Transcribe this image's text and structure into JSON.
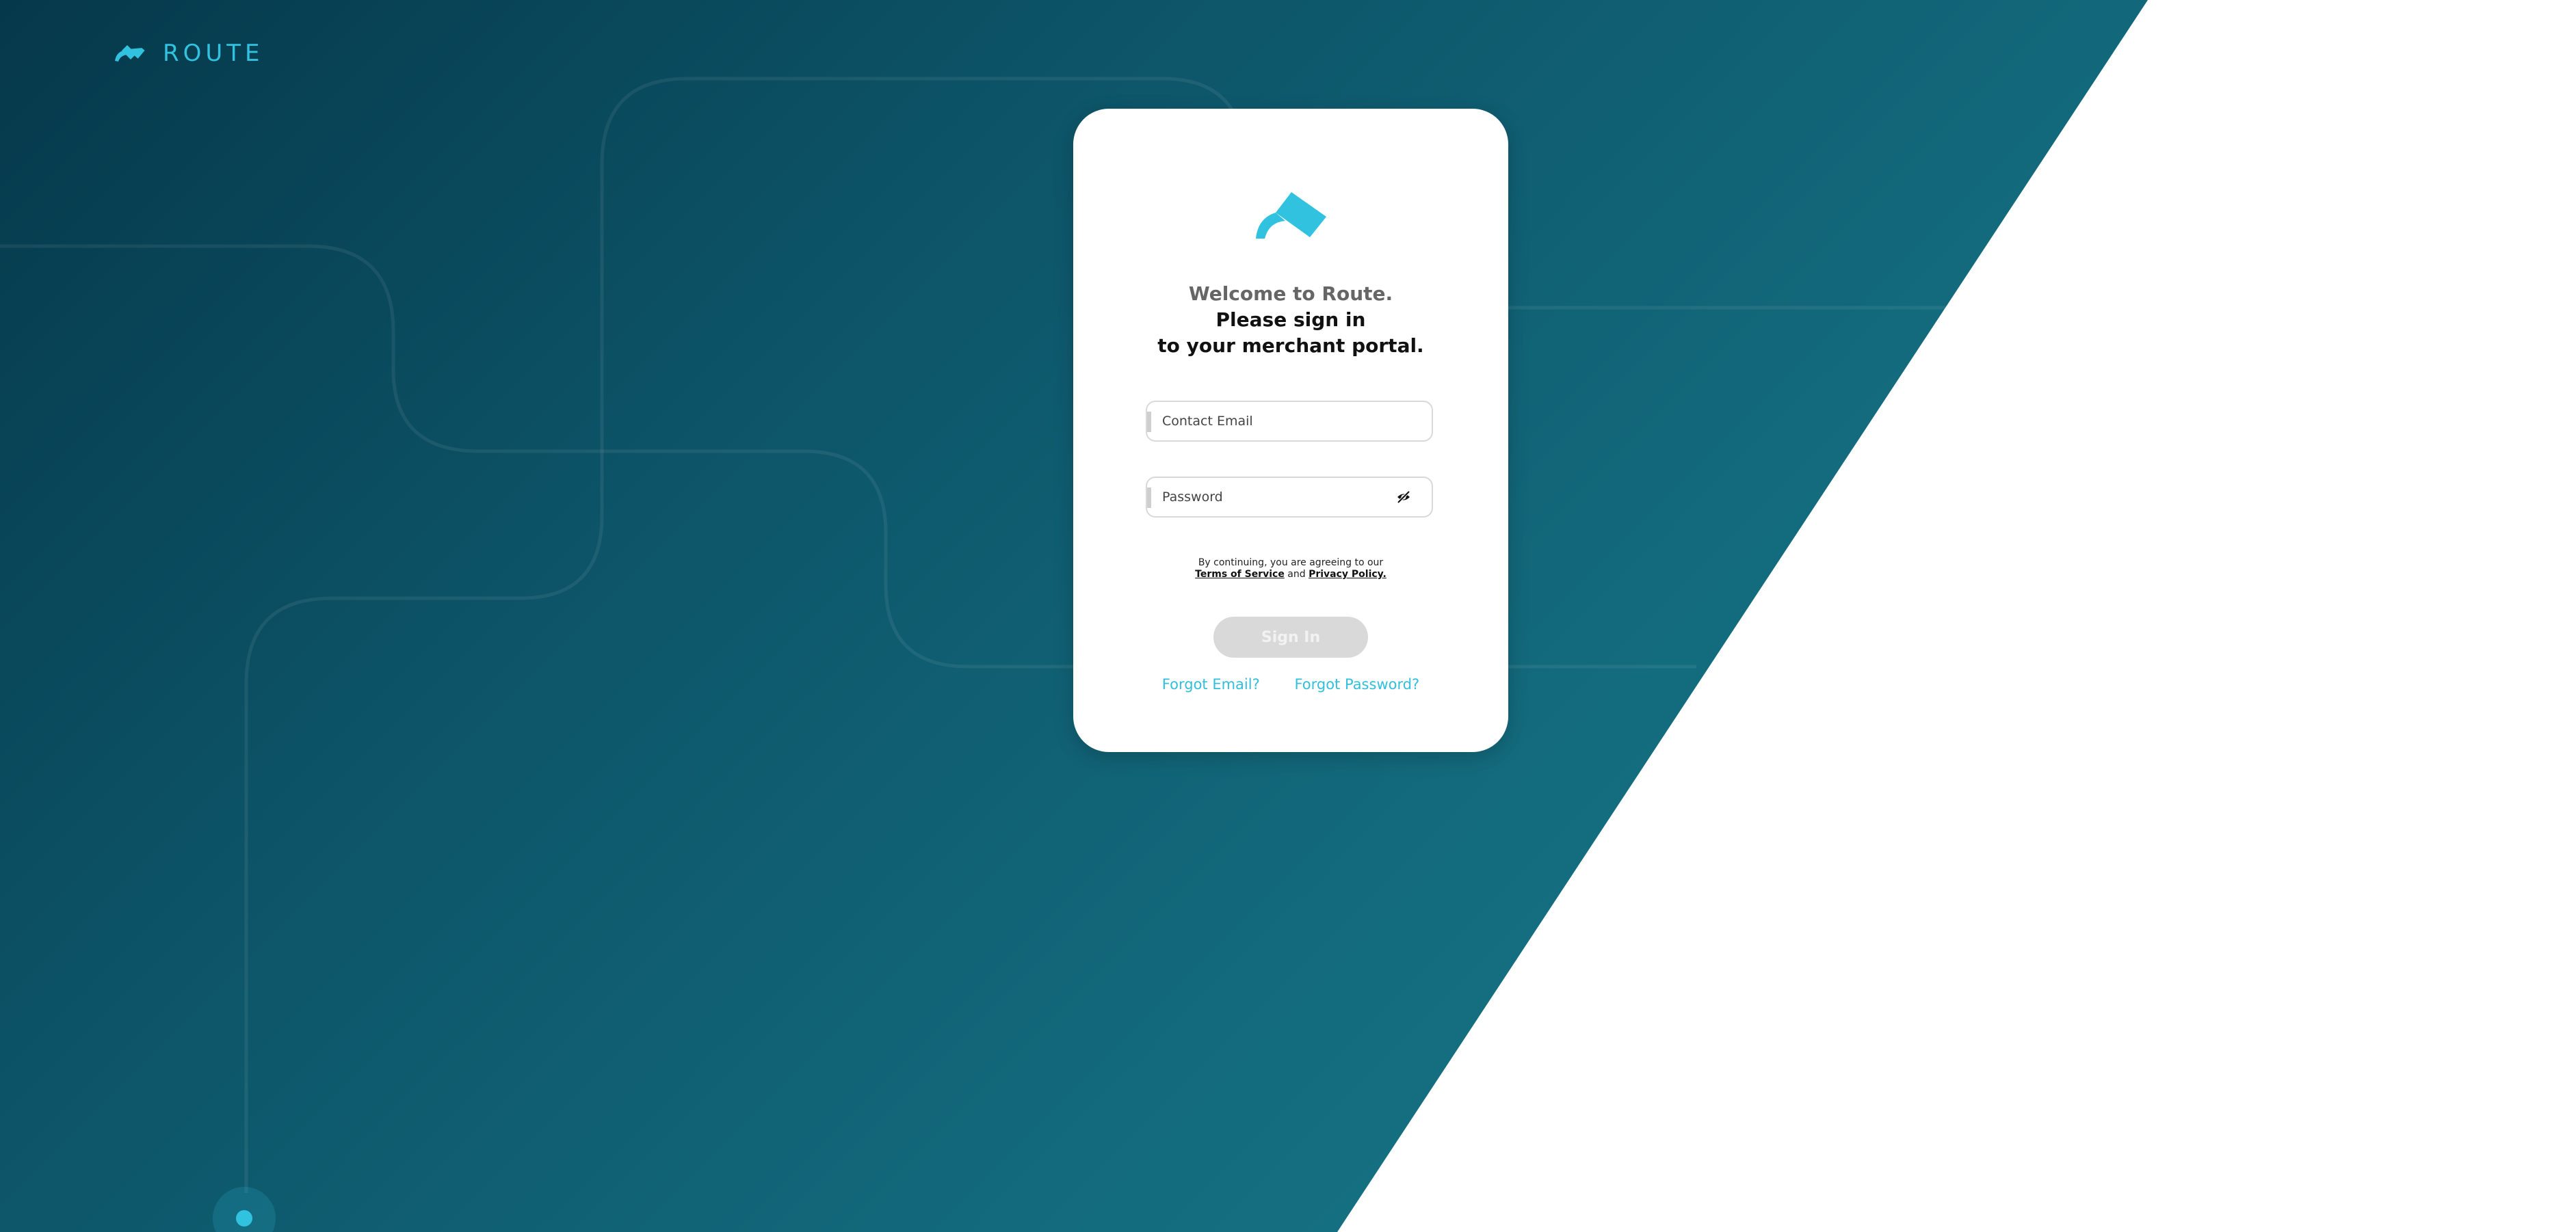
{
  "brand": {
    "name": "ROUTE",
    "accent_color": "#31c2e0",
    "background_dark": "#05384a",
    "background_light": "#178190"
  },
  "card": {
    "welcome_line1": "Welcome to Route.",
    "welcome_line2": "Please sign in",
    "welcome_line3": "to your merchant portal.",
    "email": {
      "placeholder": "Contact Email",
      "value": ""
    },
    "password": {
      "placeholder": "Password",
      "value": "",
      "toggle_icon": "eye-slash-icon"
    },
    "terms": {
      "prefix": "By continuing, you are agreeing to our",
      "terms_link": "Terms of Service",
      "conjunction": "and",
      "privacy_link": "Privacy Policy."
    },
    "signin_label": "Sign In",
    "forgot_email_label": "Forgot Email?",
    "forgot_password_label": "Forgot Password?"
  }
}
